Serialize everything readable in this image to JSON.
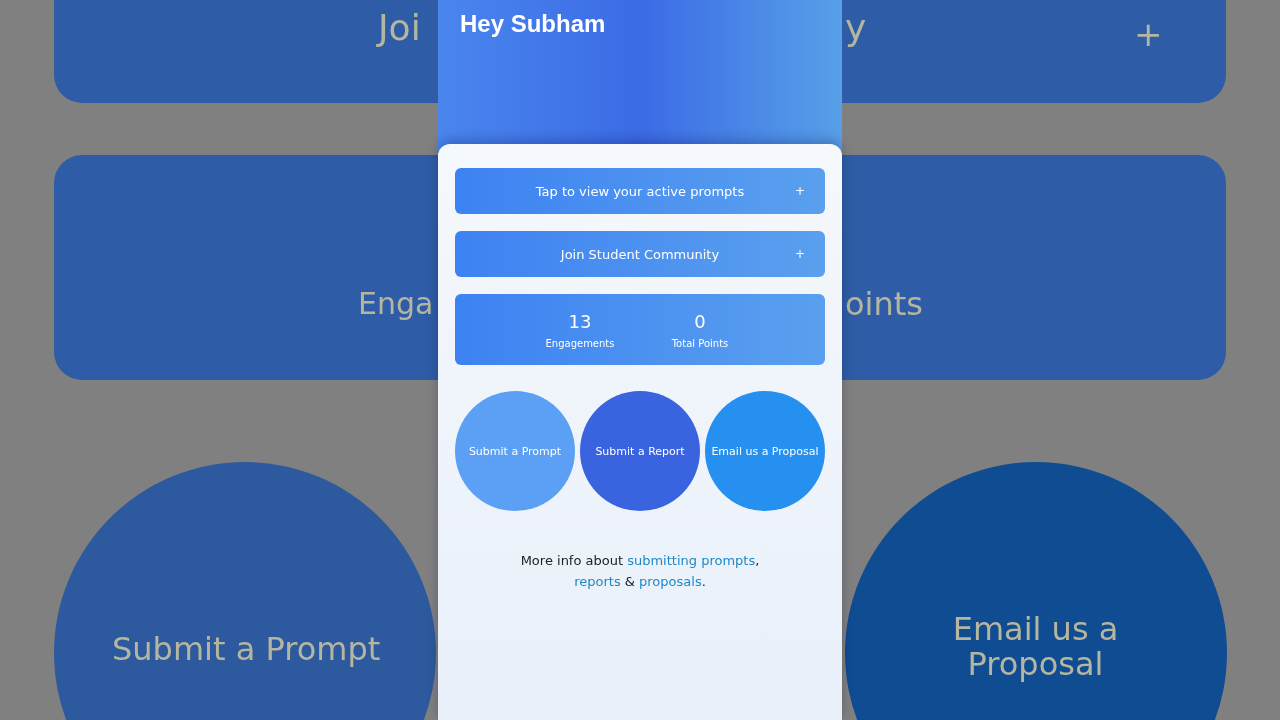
{
  "backdrop": {
    "cards": [
      {
        "texts": [
          "Joi",
          "y"
        ],
        "icon": "+"
      },
      {
        "texts": [
          "Enga",
          "oints"
        ]
      }
    ],
    "circles": [
      {
        "label": "Submit a Prompt",
        "color": "#2d5a9e"
      },
      {
        "label": "Email us a Proposal",
        "color": "#0f4c92"
      }
    ]
  },
  "header": {
    "greeting": "Hey Subham"
  },
  "accordions": [
    {
      "label": "Tap to view your active prompts",
      "icon": "+"
    },
    {
      "label": "Join Student Community",
      "icon": "+"
    }
  ],
  "stats": [
    {
      "value": "13",
      "label": "Engagements"
    },
    {
      "value": "0",
      "label": "Total Points"
    }
  ],
  "actions": [
    {
      "label": "Submit a Prompt",
      "color": "#5ba0f5"
    },
    {
      "label": "Submit a Report",
      "color": "#3a63e0"
    },
    {
      "label": "Email us a Proposal",
      "color": "#2590f0"
    }
  ],
  "footer": [
    {
      "kind": "plain",
      "text": "More info about "
    },
    {
      "kind": "link",
      "text": "submitting prompts"
    },
    {
      "kind": "plain",
      "text": ","
    },
    {
      "kind": "break"
    },
    {
      "kind": "link",
      "text": "reports"
    },
    {
      "kind": "plain",
      "text": " & "
    },
    {
      "kind": "link",
      "text": "proposals"
    },
    {
      "kind": "plain",
      "text": "."
    }
  ]
}
